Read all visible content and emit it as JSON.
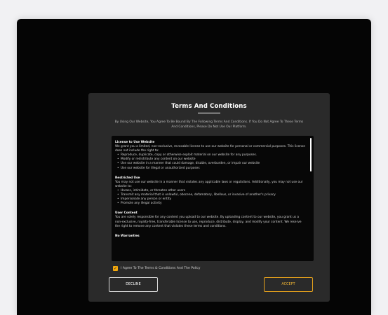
{
  "modal": {
    "title": "Terms And Conditions",
    "subtitle": "By Using Our Website, You Agree To Be Bound By The Following Terms And Conditions. If You Do Not Agree To These Terms And Conditions, Please Do Not Use Our Platform."
  },
  "terms": {
    "sections": [
      {
        "heading": "License to Use Website",
        "paragraphs": [
          "We grant you a limited, non-exclusive, revocable license to use our website for personal or commercial purposes. This license does not include the right to:"
        ],
        "bullets": [
          "Reproduce, duplicate, copy or otherwise exploit material on our website for any purposes.",
          "Modify or redistribute any content on our website",
          "Use our website in a manner that could damage, disable, overburden, or impair our website",
          "Use our website for illegal or unauthorized purposes"
        ]
      },
      {
        "heading": "Restricted Use",
        "paragraphs": [
          "You may not use our website in a manner that violates any applicable laws or regulations. Additionally, you may not use our website to:"
        ],
        "bullets": [
          "Harass, intimidate, or threaten other users",
          "Transmit any material that is unlawful, obscene, defamatory, libellous, or invasive of another's privacy",
          "Impersonate any person or entity",
          "Promote any illegal activity"
        ]
      },
      {
        "heading": "User Content",
        "paragraphs": [
          "You are solely responsible for any content you upload to our website. By uploading content to our website, you grant us a non-exclusive, royalty-free, transferable license to use, reproduce, distribute, display, and modify your content. We reserve the right to remove any content that violates these terms and conditions."
        ],
        "bullets": []
      },
      {
        "heading": "No Warranties",
        "paragraphs": [],
        "bullets": []
      }
    ]
  },
  "agreement": {
    "checked": true,
    "check_glyph": "✓",
    "label": "I Agree To The Terms & Conditions And The Policy"
  },
  "buttons": {
    "decline": "DECLINE",
    "accept": "ACCEPT"
  },
  "colors": {
    "accent": "#f4a90d",
    "modal_bg": "#2a2a2a",
    "terms_bg": "#070707",
    "page_bg": "#f1f1f3"
  },
  "icons": {
    "checkbox": "check-icon"
  }
}
